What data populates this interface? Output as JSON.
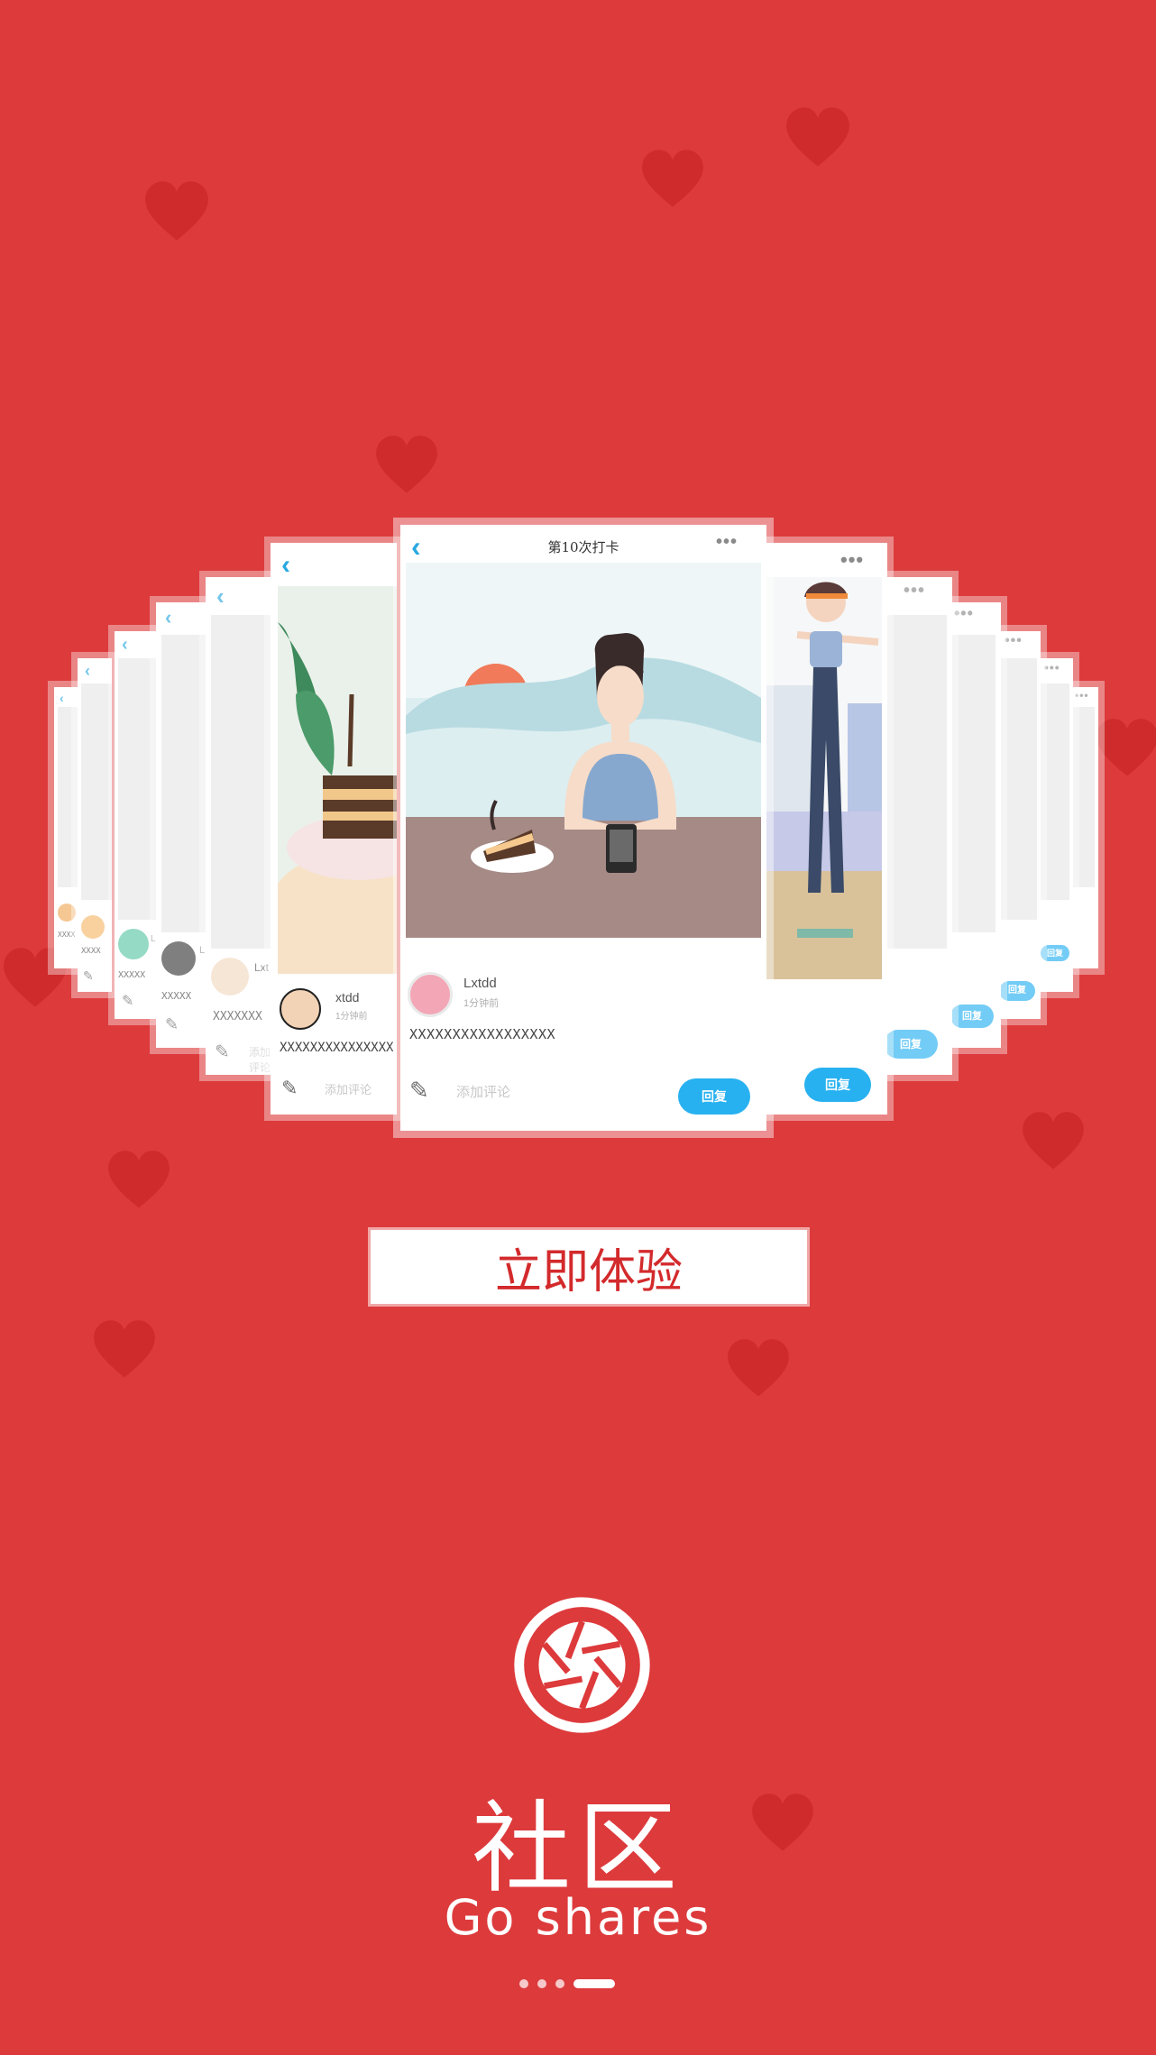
{
  "colors": {
    "background": "#dd3a3c",
    "heart": "#cf2a2c",
    "accent": "#27b1f0",
    "cta_text": "#d32a2c"
  },
  "cards": {
    "main": {
      "title": "第10次打卡",
      "back_icon": "chevron-left-icon",
      "more_icon": "more-dots-icon",
      "username": "Lxtdd",
      "time": "1分钟前",
      "body": "XXXXXXXXXXXXXXXXX",
      "comment_placeholder": "添加评论",
      "reply": "回复"
    },
    "left": [
      {
        "username": "xtdd",
        "time": "1分钟前",
        "body": "XXXXXXXXXXXXXXX",
        "comment_placeholder": "添加评论"
      },
      {
        "username": "Lxt",
        "body": "XXXXXXX",
        "comment_placeholder": "添加评论"
      },
      {
        "username": "L",
        "body": "XXXXX"
      },
      {
        "username": "L",
        "body": "XXXXX"
      },
      {
        "username": "L",
        "body": "XXXX"
      },
      {
        "username": "",
        "body": "XXXX"
      }
    ],
    "right": [
      {
        "reply": "回复"
      },
      {
        "reply": "回复"
      },
      {
        "reply": "回复"
      },
      {
        "reply": "回复"
      },
      {
        "reply": "回复"
      },
      {
        "reply": ""
      }
    ]
  },
  "cta": {
    "label": "立即体验"
  },
  "brand": {
    "title": "社区",
    "subtitle": "Go shares",
    "logo_icon": "camera-aperture-icon"
  },
  "pager": {
    "total": 4,
    "current": 4
  }
}
